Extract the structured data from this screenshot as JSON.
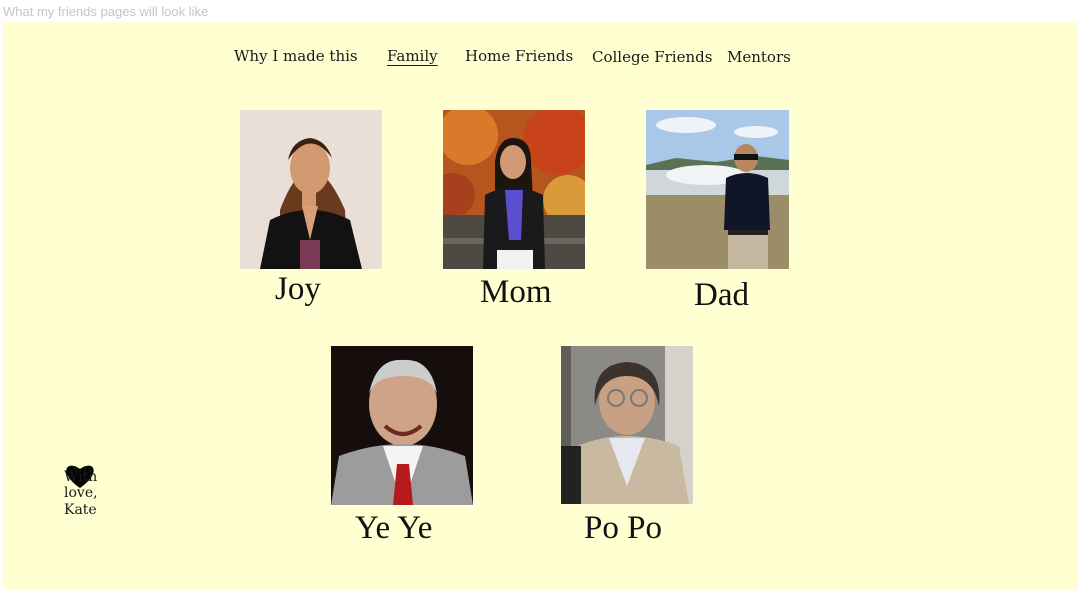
{
  "frame_title": "What my friends pages will look like",
  "nav": {
    "items": [
      {
        "label": "Why I made this",
        "active": false
      },
      {
        "label": "Family",
        "active": true
      },
      {
        "label": "Home Friends",
        "active": false
      },
      {
        "label": "College Friends",
        "active": false
      },
      {
        "label": "Mentors",
        "active": false
      }
    ]
  },
  "people": [
    {
      "name": "Joy"
    },
    {
      "name": "Mom"
    },
    {
      "name": "Dad"
    },
    {
      "name": "Ye Ye"
    },
    {
      "name": "Po Po"
    }
  ],
  "footer": {
    "icon": "heart-icon",
    "lines": [
      "With",
      "love,",
      "Kate"
    ]
  },
  "colors": {
    "background": "#ffffd1",
    "text": "#111111",
    "label": "#c4c4c4"
  }
}
